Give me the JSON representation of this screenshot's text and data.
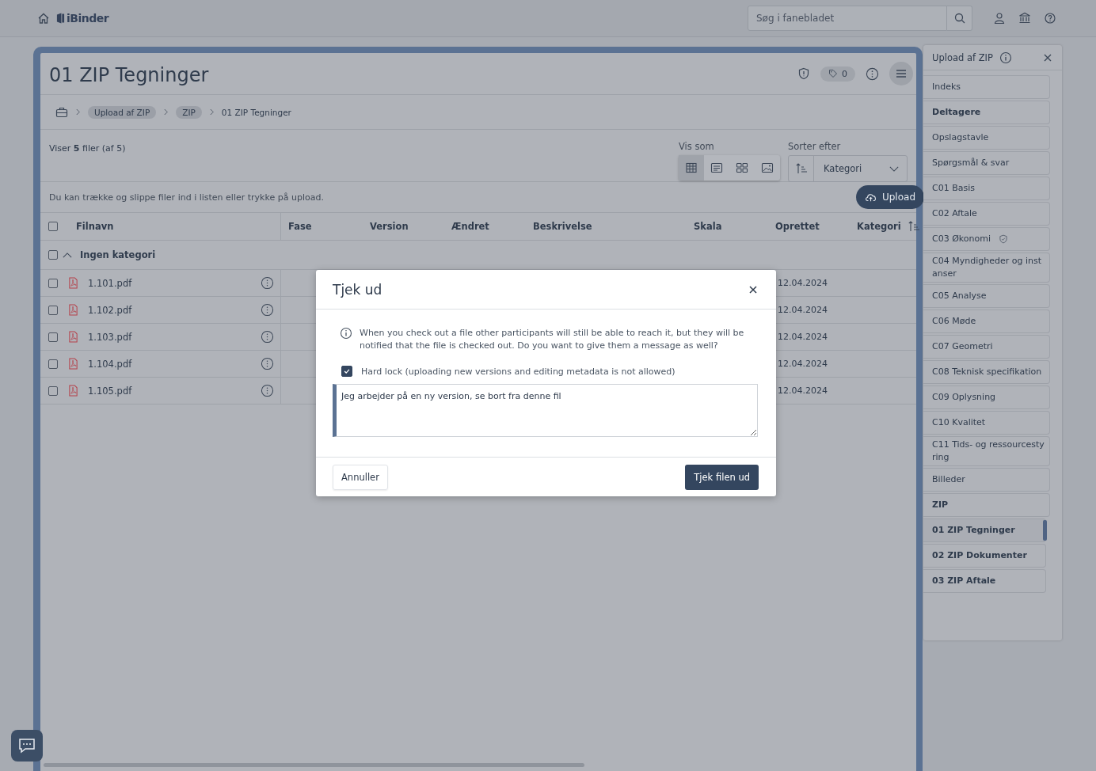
{
  "topbar": {
    "logo": "iBinder",
    "search": {
      "placeholder": "Søg i fanebladet"
    }
  },
  "page": {
    "title": "01 ZIP Tegninger",
    "tag_count": "0",
    "breadcrumb": [
      {
        "label": "Upload af ZIP",
        "kind": "pill"
      },
      {
        "label": "ZIP",
        "kind": "pill"
      },
      {
        "label": "01 ZIP Tegninger",
        "kind": "plain"
      }
    ],
    "summary": "Viser **5** filer (af 5)",
    "view_label": "Vis som",
    "view_modes": [
      {
        "kind": "table",
        "selected": true
      },
      {
        "kind": "list",
        "selected": false
      },
      {
        "kind": "grid",
        "selected": false
      },
      {
        "kind": "image",
        "selected": false
      }
    ],
    "sort_label": "Sorter efter",
    "sort_value": "Kategori",
    "hint": "Du kan trække og slippe filer ind i listen eller trykke på upload.",
    "upload_button": "Upload"
  },
  "table": {
    "header_checked": false,
    "columns": [
      "Filnavn",
      "Fase",
      "Version",
      "Ændret",
      "Beskrivelse",
      "Skala",
      "Oprettet",
      "Kategori"
    ],
    "group": {
      "label": "Ingen kategori",
      "expanded": true,
      "checked": false
    },
    "rows": [
      {
        "name": "1.101.pdf",
        "created": "12.04.2024",
        "checked": false
      },
      {
        "name": "1.102.pdf",
        "created": "12.04.2024",
        "checked": false
      },
      {
        "name": "1.103.pdf",
        "created": "12.04.2024",
        "checked": false
      },
      {
        "name": "1.104.pdf",
        "created": "12.04.2024",
        "checked": false
      },
      {
        "name": "1.105.pdf",
        "created": "12.04.2024",
        "checked": false
      }
    ]
  },
  "sidebar": {
    "title": "Upload af ZIP",
    "items": [
      {
        "label": "Indeks",
        "kind": "page",
        "selected": false
      },
      {
        "label": "Deltagere",
        "kind": "heading",
        "selected": false
      },
      {
        "label": "Opslagstavle",
        "kind": "page",
        "selected": false
      },
      {
        "label": "Spørgsmål & svar",
        "kind": "page",
        "selected": false
      },
      {
        "label": "C01 Basis",
        "kind": "page",
        "selected": false
      },
      {
        "label": "C02 Aftale",
        "kind": "page",
        "selected": false
      },
      {
        "label": "C03 Økonomi",
        "kind": "page",
        "selected": false,
        "protected": true
      },
      {
        "label": "C04 Myndigheder og instanser",
        "kind": "page",
        "selected": false
      },
      {
        "label": "C05 Analyse",
        "kind": "page",
        "selected": false
      },
      {
        "label": "C06 Møde",
        "kind": "page",
        "selected": false
      },
      {
        "label": "C07 Geometri",
        "kind": "page",
        "selected": false
      },
      {
        "label": "C08 Teknisk specifikation",
        "kind": "page",
        "selected": false
      },
      {
        "label": "C09 Oplysning",
        "kind": "page",
        "selected": false
      },
      {
        "label": "C10 Kvalitet",
        "kind": "page",
        "selected": false
      },
      {
        "label": "C11 Tids- og ressourcestyring",
        "kind": "page",
        "selected": false
      },
      {
        "label": "Billeder",
        "kind": "page",
        "selected": false
      },
      {
        "label": "ZIP",
        "kind": "heading",
        "selected": false,
        "children": [
          {
            "label": "01 ZIP Tegninger",
            "kind": "heading",
            "selected": true
          },
          {
            "label": "02 ZIP Dokumenter",
            "kind": "heading",
            "selected": false
          },
          {
            "label": "03 ZIP Aftale",
            "kind": "heading",
            "selected": false
          }
        ]
      }
    ]
  },
  "dialog": {
    "title": "Tjek ud",
    "info": "When you check out a file other participants will still be able to reach it, but they will be notified that the file is checked out. Do you want to give them a message as well?",
    "hard_lock": {
      "label": "Hard lock (uploading new versions and editing metadata is not allowed)",
      "checked": true
    },
    "message": "Jeg arbejder på en ny version, se bort fra denne fil",
    "cancel": "Annuller",
    "confirm": "Tjek filen ud"
  }
}
